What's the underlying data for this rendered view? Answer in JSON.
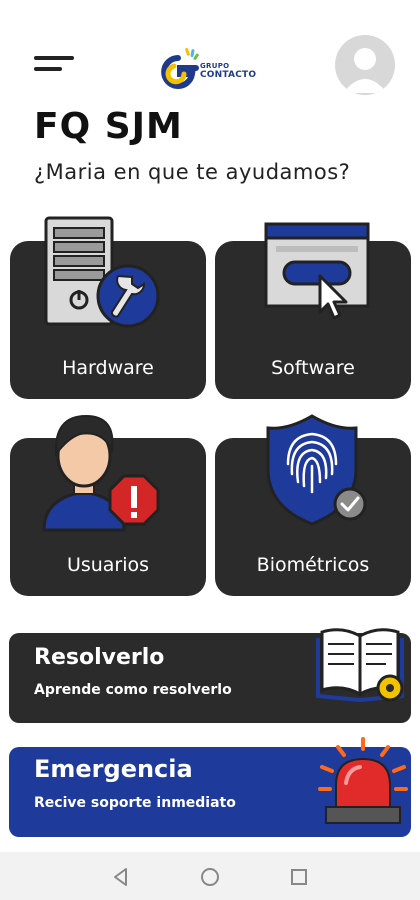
{
  "header": {
    "logo_line1": "GRUPO",
    "logo_line2": "CONTACTO",
    "logo_colors": [
      "#f2c200",
      "#1f3a8a",
      "#4fb3e8",
      "#6cc04a"
    ]
  },
  "page": {
    "title": "FQ SJM",
    "greeting": "¿Maria en que te ayudamos?"
  },
  "categories": [
    {
      "label": "Hardware",
      "icon": "server-wrench-icon"
    },
    {
      "label": "Software",
      "icon": "browser-cursor-icon"
    },
    {
      "label": "Usuarios",
      "icon": "user-alert-icon"
    },
    {
      "label": "Biométricos",
      "icon": "fingerprint-shield-icon"
    }
  ],
  "resolve_banner": {
    "title": "Resolverlo",
    "subtitle": "Aprende como resolverlo",
    "icon": "open-book-gear-icon",
    "color": "#2b2b2b"
  },
  "emergency_banner": {
    "title": "Emergencia",
    "subtitle": "Recive soporte inmediato",
    "icon": "siren-icon",
    "color": "#1e3a9a"
  },
  "system_nav": {
    "icons": [
      "back-icon",
      "home-icon",
      "recents-icon"
    ]
  }
}
